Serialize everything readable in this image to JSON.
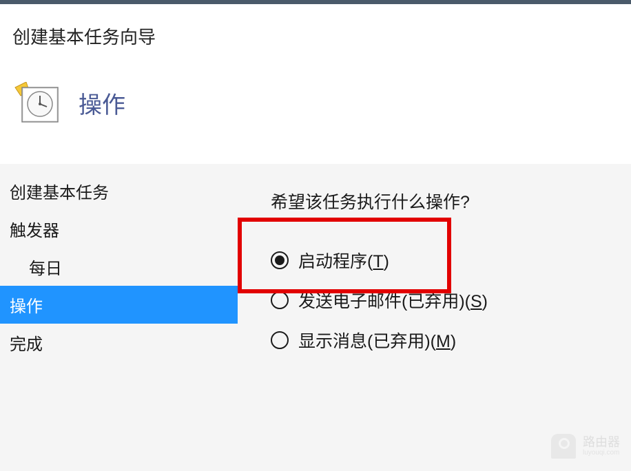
{
  "header": {
    "wizard_title": "创建基本任务向导",
    "step_title": "操作"
  },
  "sidebar": {
    "items": [
      {
        "label": "创建基本任务",
        "indented": false,
        "selected": false
      },
      {
        "label": "触发器",
        "indented": false,
        "selected": false
      },
      {
        "label": "每日",
        "indented": true,
        "selected": false
      },
      {
        "label": "操作",
        "indented": false,
        "selected": true
      },
      {
        "label": "完成",
        "indented": false,
        "selected": false
      }
    ]
  },
  "content": {
    "question": "希望该任务执行什么操作?",
    "options": [
      {
        "label_pre": "启动程序(",
        "hotkey": "T",
        "label_post": ")",
        "checked": true
      },
      {
        "label_pre": "发送电子邮件(已弃用)(",
        "hotkey": "S",
        "label_post": ")",
        "checked": false
      },
      {
        "label_pre": "显示消息(已弃用)(",
        "hotkey": "M",
        "label_post": ")",
        "checked": false
      }
    ]
  },
  "watermark": {
    "main": "路由器",
    "sub": "luyouqi.com"
  }
}
